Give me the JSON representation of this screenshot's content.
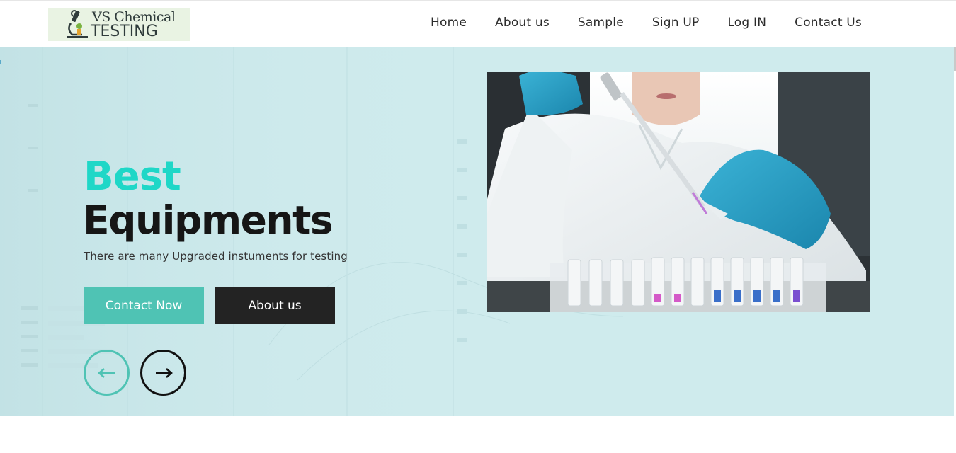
{
  "brand": {
    "line1": "VS Chemical",
    "line2": "TESTING"
  },
  "nav": {
    "items": [
      {
        "label": "Home"
      },
      {
        "label": "About us"
      },
      {
        "label": "Sample"
      },
      {
        "label": "Sign UP"
      },
      {
        "label": "Log IN"
      },
      {
        "label": "Contact Us"
      }
    ]
  },
  "hero": {
    "headline_accent": "Best",
    "headline_main": "Equipments",
    "subtitle": "There are many Upgraded instuments for testing",
    "primary_button": "Contact Now",
    "secondary_button": "About us",
    "prev_icon": "arrow-left-icon",
    "next_icon": "arrow-right-icon"
  },
  "colors": {
    "accent": "#1fd7c7",
    "button_teal": "#4fc3b4",
    "button_dark": "#232323",
    "hero_bg": "#cfebed"
  }
}
